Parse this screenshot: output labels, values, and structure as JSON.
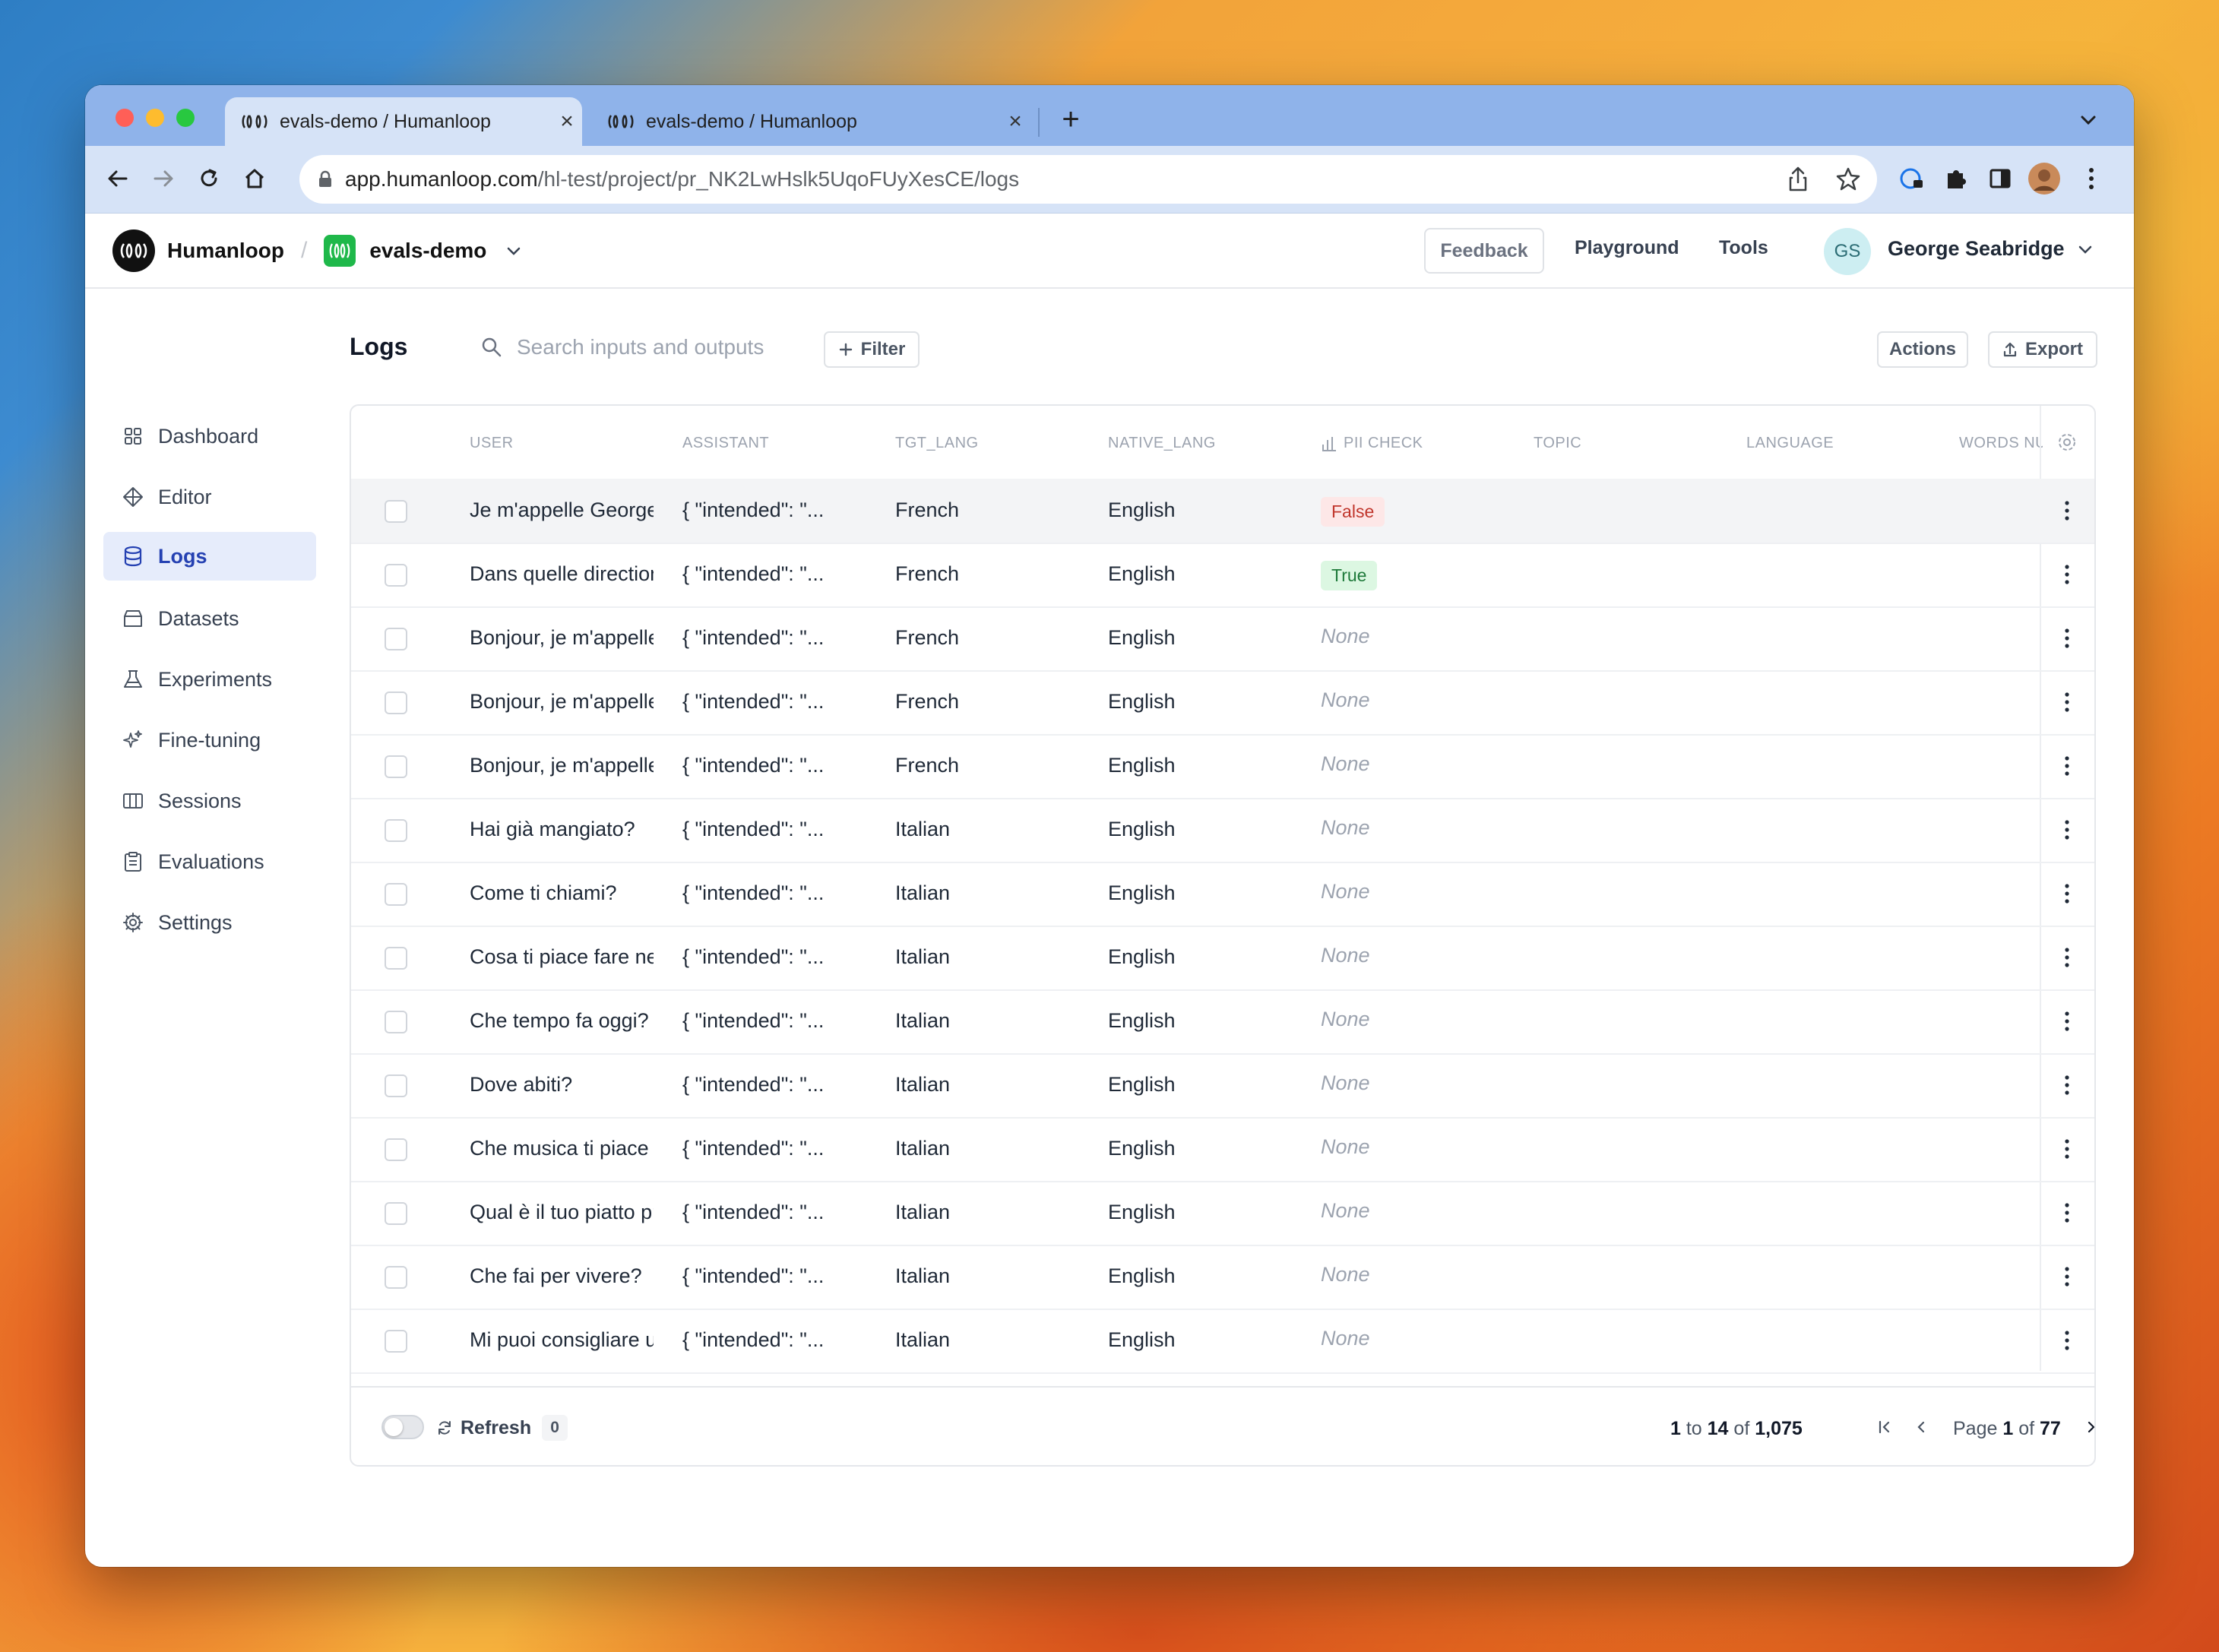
{
  "browser": {
    "tabs": [
      {
        "title": "evals-demo / Humanloop",
        "active": true
      },
      {
        "title": "evals-demo / Humanloop",
        "active": false
      }
    ],
    "url_host": "app.humanloop.com",
    "url_path": "/hl-test/project/pr_NK2LwHslk5UqoFUyXesCE/logs"
  },
  "header": {
    "brand": "Humanloop",
    "project": "evals-demo",
    "feedback": "Feedback",
    "playground": "Playground",
    "tools": "Tools",
    "user_initials": "GS",
    "user_name": "George Seabridge"
  },
  "sidebar": {
    "items": [
      {
        "label": "Dashboard",
        "icon": "grid-icon"
      },
      {
        "label": "Editor",
        "icon": "diamond-icon"
      },
      {
        "label": "Logs",
        "icon": "database-icon",
        "active": true
      },
      {
        "label": "Datasets",
        "icon": "archive-icon"
      },
      {
        "label": "Experiments",
        "icon": "beaker-icon"
      },
      {
        "label": "Fine-tuning",
        "icon": "sparkles-icon"
      },
      {
        "label": "Sessions",
        "icon": "columns-icon"
      },
      {
        "label": "Evaluations",
        "icon": "clipboard-icon"
      },
      {
        "label": "Settings",
        "icon": "gear-icon"
      }
    ]
  },
  "main": {
    "title": "Logs",
    "search_placeholder": "Search inputs and outputs",
    "filter": "Filter",
    "actions": "Actions",
    "export": "Export"
  },
  "table": {
    "columns": [
      "USER",
      "ASSISTANT",
      "TGT_LANG",
      "NATIVE_LANG",
      "PII CHECK",
      "TOPIC",
      "LANGUAGE",
      "WORDS NU"
    ],
    "rows": [
      {
        "user": "Je m'appelle George",
        "assistant": "{ \"intended\": \"...",
        "tgt_lang": "French",
        "native_lang": "English",
        "pii": "False"
      },
      {
        "user": "Dans quelle direction",
        "assistant": "{ \"intended\": \"...",
        "tgt_lang": "French",
        "native_lang": "English",
        "pii": "True"
      },
      {
        "user": "Bonjour, je m'appelle",
        "assistant": "{ \"intended\": \"...",
        "tgt_lang": "French",
        "native_lang": "English",
        "pii": "None"
      },
      {
        "user": "Bonjour, je m'appelle",
        "assistant": "{ \"intended\": \"...",
        "tgt_lang": "French",
        "native_lang": "English",
        "pii": "None"
      },
      {
        "user": "Bonjour, je m'appelle",
        "assistant": "{ \"intended\": \"...",
        "tgt_lang": "French",
        "native_lang": "English",
        "pii": "None"
      },
      {
        "user": "Hai già mangiato?",
        "assistant": "{ \"intended\": \"...",
        "tgt_lang": "Italian",
        "native_lang": "English",
        "pii": "None"
      },
      {
        "user": "Come ti chiami?",
        "assistant": "{ \"intended\": \"...",
        "tgt_lang": "Italian",
        "native_lang": "English",
        "pii": "None"
      },
      {
        "user": "Cosa ti piace fare nel",
        "assistant": "{ \"intended\": \"...",
        "tgt_lang": "Italian",
        "native_lang": "English",
        "pii": "None"
      },
      {
        "user": "Che tempo fa oggi?",
        "assistant": "{ \"intended\": \"...",
        "tgt_lang": "Italian",
        "native_lang": "English",
        "pii": "None"
      },
      {
        "user": "Dove abiti?",
        "assistant": "{ \"intended\": \"...",
        "tgt_lang": "Italian",
        "native_lang": "English",
        "pii": "None"
      },
      {
        "user": "Che musica ti piace",
        "assistant": "{ \"intended\": \"...",
        "tgt_lang": "Italian",
        "native_lang": "English",
        "pii": "None"
      },
      {
        "user": "Qual è il tuo piatto preferito",
        "assistant": "{ \"intended\": \"...",
        "tgt_lang": "Italian",
        "native_lang": "English",
        "pii": "None"
      },
      {
        "user": "Che fai per vivere?",
        "assistant": "{ \"intended\": \"...",
        "tgt_lang": "Italian",
        "native_lang": "English",
        "pii": "None"
      },
      {
        "user": "Mi puoi consigliare un",
        "assistant": "{ \"intended\": \"...",
        "tgt_lang": "Italian",
        "native_lang": "English",
        "pii": "None"
      }
    ]
  },
  "footer": {
    "refresh": "Refresh",
    "refresh_count": "0",
    "range_from": "1",
    "range_to": "14",
    "range_total": "1,075",
    "page_current": "1",
    "page_total": "77"
  },
  "colors": {
    "accent": "#2541b2",
    "brand_green": "#1fb84a",
    "false_badge": "#c0362c",
    "true_badge": "#1e7a3a"
  }
}
